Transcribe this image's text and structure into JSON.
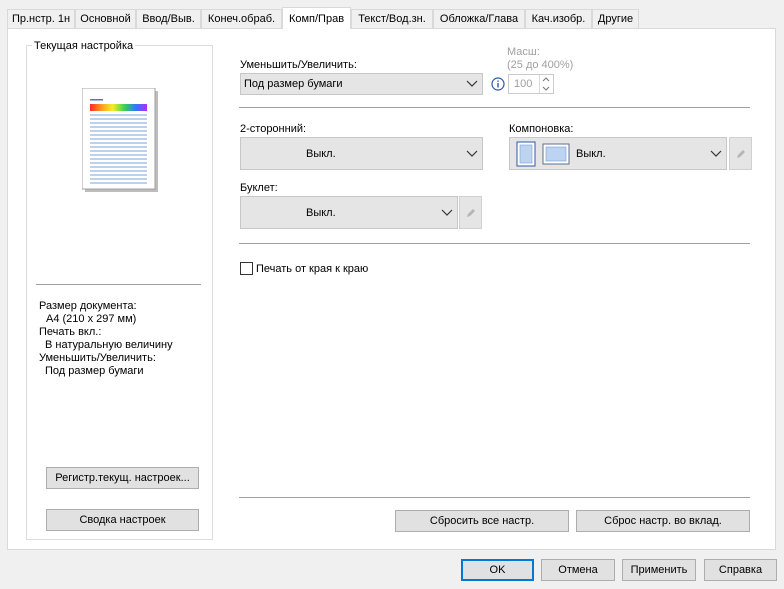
{
  "tabs": [
    {
      "label": "Пр.нстр. 1н",
      "active": false
    },
    {
      "label": "Основной",
      "active": false
    },
    {
      "label": "Ввод/Выв.",
      "active": false
    },
    {
      "label": "Конеч.обраб.",
      "active": false
    },
    {
      "label": "Комп/Прав",
      "active": true
    },
    {
      "label": "Текст/Вод.зн.",
      "active": false
    },
    {
      "label": "Обложка/Глава",
      "active": false
    },
    {
      "label": "Кач.изобр.",
      "active": false
    },
    {
      "label": "Другие",
      "active": false
    }
  ],
  "current": {
    "legend": "Текущая настройка",
    "info": [
      "Размер документа:",
      "A4 (210 x 297 мм)",
      "Печать вкл.:",
      "В натуральную величину",
      "Уменьшить/Увеличить:",
      "Под размер бумаги"
    ],
    "register_button": "Регистр.текущ. настроек...",
    "summary_button": "Сводка настроек"
  },
  "zoom": {
    "label": "Уменьшить/Увеличить:",
    "value": "Под размер бумаги",
    "scale_label": "Масш:",
    "scale_range": "(25 до 400%)",
    "scale_value": "100"
  },
  "duplex": {
    "label": "2-сторонний:",
    "value": "Выкл."
  },
  "layout": {
    "label": "Компоновка:",
    "value": "Выкл."
  },
  "booklet": {
    "label": "Буклет:",
    "value": "Выкл."
  },
  "edge_to_edge": {
    "label": "Печать от края к краю",
    "checked": false
  },
  "reset_all_button": "Сбросить все настр.",
  "reset_tab_button": "Сброс настр. во вклад.",
  "footer": {
    "ok": "OK",
    "cancel": "Отмена",
    "apply": "Применить",
    "help": "Справка"
  }
}
